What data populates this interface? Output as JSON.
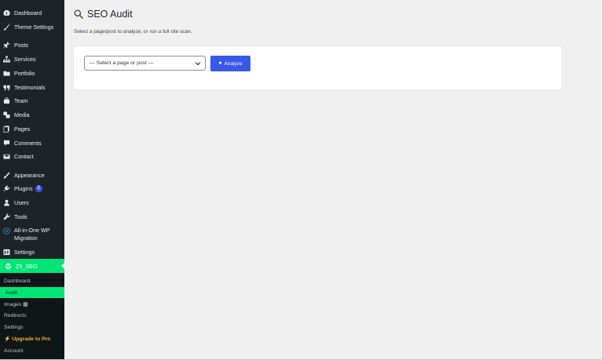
{
  "sidebar": {
    "items": [
      {
        "label": "Dashboard",
        "icon": "dashboard-icon"
      },
      {
        "label": "Theme Settings",
        "icon": "brush-icon"
      },
      {
        "label": "Posts",
        "icon": "pin-icon"
      },
      {
        "label": "Services",
        "icon": "sitemap-icon"
      },
      {
        "label": "Portfolio",
        "icon": "folder-icon"
      },
      {
        "label": "Testimonials",
        "icon": "quote-icon"
      },
      {
        "label": "Team",
        "icon": "team-icon"
      },
      {
        "label": "Media",
        "icon": "media-icon"
      },
      {
        "label": "Pages",
        "icon": "pages-icon"
      },
      {
        "label": "Comments",
        "icon": "comment-icon"
      },
      {
        "label": "Contact",
        "icon": "mail-icon"
      },
      {
        "label": "Appearance",
        "icon": "paintbrush-icon"
      },
      {
        "label": "Plugins",
        "icon": "plugin-icon",
        "badge": "3"
      },
      {
        "label": "Users",
        "icon": "user-icon"
      },
      {
        "label": "Tools",
        "icon": "wrench-icon"
      },
      {
        "label": "All-in-One WP",
        "label2": "Migration",
        "icon": "migration-icon"
      },
      {
        "label": "Settings",
        "icon": "settings-icon"
      }
    ],
    "active": {
      "label": "Z5_SEO",
      "icon": "z5-seo-icon"
    },
    "submenu": [
      {
        "label": "Dashboard"
      },
      {
        "label": "Audit"
      },
      {
        "label": "Images ▦"
      },
      {
        "label": "Redirects"
      },
      {
        "label": "Settings"
      },
      {
        "label": "⚡ Upgrade to Pro"
      },
      {
        "label": "Account"
      }
    ]
  },
  "page": {
    "title": "SEO Audit",
    "subtitle": "Select a page/post to analyze, or run a full site scan."
  },
  "form": {
    "select_value": "— Select a page or post —",
    "analyze_label": "Analyze"
  },
  "colors": {
    "sidebar_bg": "#1d2327",
    "accent_green": "#00e676",
    "button_blue": "#3858e9",
    "pro_orange": "#f0b429"
  }
}
